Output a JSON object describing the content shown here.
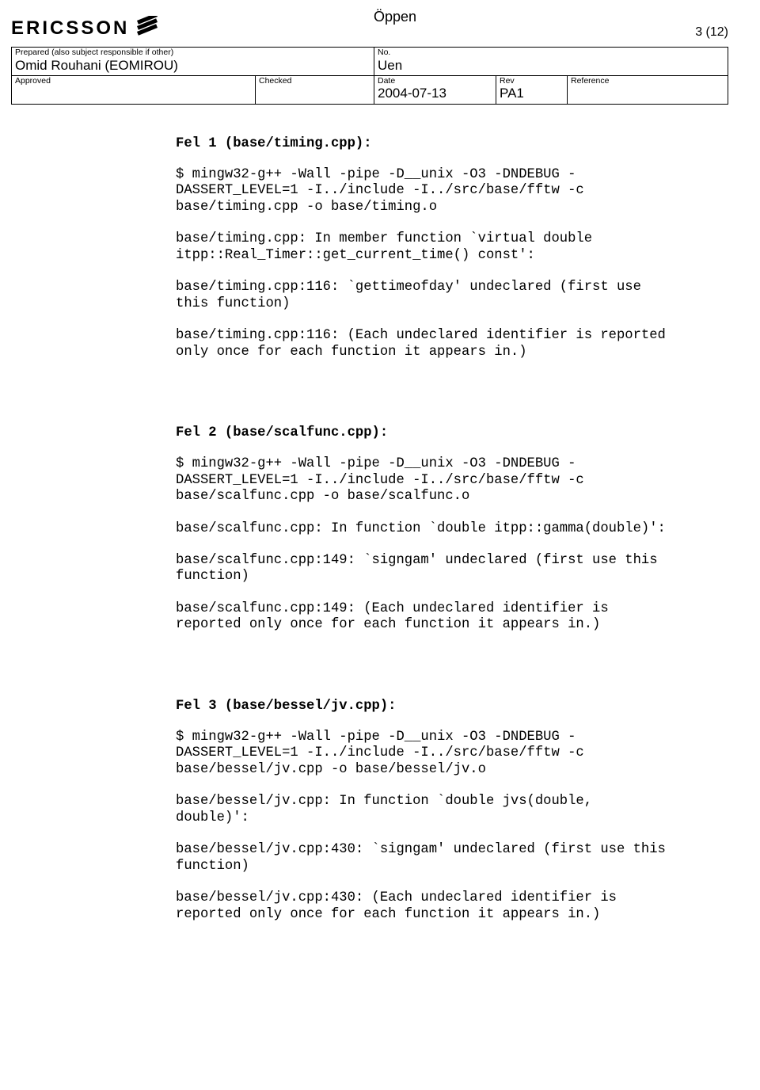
{
  "classification": "Öppen",
  "page_number": "3 (12)",
  "logo_text": "ERICSSON",
  "header": {
    "prepared_label": "Prepared (also subject responsible if other)",
    "prepared_value": "Omid Rouhani (EOMIROU)",
    "no_label": "No.",
    "no_value": "Uen",
    "approved_label": "Approved",
    "approved_value": "",
    "checked_label": "Checked",
    "checked_value": "",
    "date_label": "Date",
    "date_value": "2004-07-13",
    "rev_label": "Rev",
    "rev_value": "PA1",
    "reference_label": "Reference",
    "reference_value": ""
  },
  "sections": [
    {
      "title": "Fel 1 (base/timing.cpp):",
      "paras": [
        "$ mingw32-g++ -Wall -pipe -D__unix -O3 -DNDEBUG -DASSERT_LEVEL=1 -I../include -I../src/base/fftw -c base/timing.cpp -o base/timing.o",
        "base/timing.cpp: In member function `virtual double itpp::Real_Timer::get_current_time() const':",
        "base/timing.cpp:116: `gettimeofday' undeclared (first use this function)",
        "base/timing.cpp:116: (Each undeclared identifier is reported only once for each function it appears in.)"
      ]
    },
    {
      "title": "Fel 2 (base/scalfunc.cpp):",
      "paras": [
        "$ mingw32-g++ -Wall -pipe -D__unix -O3 -DNDEBUG -DASSERT_LEVEL=1 -I../include -I../src/base/fftw -c base/scalfunc.cpp -o base/scalfunc.o",
        "base/scalfunc.cpp: In function `double itpp::gamma(double)':",
        "base/scalfunc.cpp:149: `signgam' undeclared (first use this function)",
        "base/scalfunc.cpp:149: (Each undeclared identifier is reported only once for each function it appears in.)"
      ]
    },
    {
      "title": "Fel 3 (base/bessel/jv.cpp):",
      "paras": [
        "$ mingw32-g++ -Wall -pipe -D__unix -O3 -DNDEBUG -DASSERT_LEVEL=1 -I../include -I../src/base/fftw -c base/bessel/jv.cpp -o base/bessel/jv.o",
        "base/bessel/jv.cpp: In function `double jvs(double, double)':",
        "base/bessel/jv.cpp:430: `signgam' undeclared (first use this function)",
        "base/bessel/jv.cpp:430: (Each undeclared identifier is reported only once for each function it appears in.)"
      ]
    }
  ]
}
